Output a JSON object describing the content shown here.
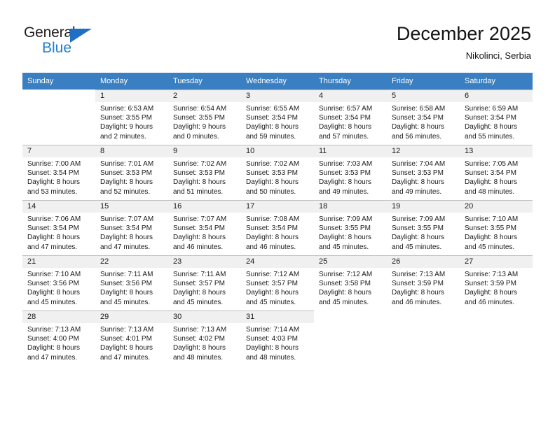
{
  "brand": {
    "name_part1": "General",
    "name_part2": "Blue",
    "triangle_color": "#1f6fc4",
    "blue_color": "#1f7fd0"
  },
  "header": {
    "month_title": "December 2025",
    "location": "Nikolinci, Serbia"
  },
  "calendar": {
    "header_bg": "#3a7fc1",
    "daynum_bg": "#f0f0f0",
    "weekday_headers": [
      "Sunday",
      "Monday",
      "Tuesday",
      "Wednesday",
      "Thursday",
      "Friday",
      "Saturday"
    ],
    "weeks": [
      [
        {
          "day": "",
          "sunrise": "",
          "sunset": "",
          "daylight_1": "",
          "daylight_2": "",
          "empty": true
        },
        {
          "day": "1",
          "sunrise": "Sunrise: 6:53 AM",
          "sunset": "Sunset: 3:55 PM",
          "daylight_1": "Daylight: 9 hours",
          "daylight_2": "and 2 minutes.",
          "empty": false
        },
        {
          "day": "2",
          "sunrise": "Sunrise: 6:54 AM",
          "sunset": "Sunset: 3:55 PM",
          "daylight_1": "Daylight: 9 hours",
          "daylight_2": "and 0 minutes.",
          "empty": false
        },
        {
          "day": "3",
          "sunrise": "Sunrise: 6:55 AM",
          "sunset": "Sunset: 3:54 PM",
          "daylight_1": "Daylight: 8 hours",
          "daylight_2": "and 59 minutes.",
          "empty": false
        },
        {
          "day": "4",
          "sunrise": "Sunrise: 6:57 AM",
          "sunset": "Sunset: 3:54 PM",
          "daylight_1": "Daylight: 8 hours",
          "daylight_2": "and 57 minutes.",
          "empty": false
        },
        {
          "day": "5",
          "sunrise": "Sunrise: 6:58 AM",
          "sunset": "Sunset: 3:54 PM",
          "daylight_1": "Daylight: 8 hours",
          "daylight_2": "and 56 minutes.",
          "empty": false
        },
        {
          "day": "6",
          "sunrise": "Sunrise: 6:59 AM",
          "sunset": "Sunset: 3:54 PM",
          "daylight_1": "Daylight: 8 hours",
          "daylight_2": "and 55 minutes.",
          "empty": false
        }
      ],
      [
        {
          "day": "7",
          "sunrise": "Sunrise: 7:00 AM",
          "sunset": "Sunset: 3:54 PM",
          "daylight_1": "Daylight: 8 hours",
          "daylight_2": "and 53 minutes.",
          "empty": false
        },
        {
          "day": "8",
          "sunrise": "Sunrise: 7:01 AM",
          "sunset": "Sunset: 3:53 PM",
          "daylight_1": "Daylight: 8 hours",
          "daylight_2": "and 52 minutes.",
          "empty": false
        },
        {
          "day": "9",
          "sunrise": "Sunrise: 7:02 AM",
          "sunset": "Sunset: 3:53 PM",
          "daylight_1": "Daylight: 8 hours",
          "daylight_2": "and 51 minutes.",
          "empty": false
        },
        {
          "day": "10",
          "sunrise": "Sunrise: 7:02 AM",
          "sunset": "Sunset: 3:53 PM",
          "daylight_1": "Daylight: 8 hours",
          "daylight_2": "and 50 minutes.",
          "empty": false
        },
        {
          "day": "11",
          "sunrise": "Sunrise: 7:03 AM",
          "sunset": "Sunset: 3:53 PM",
          "daylight_1": "Daylight: 8 hours",
          "daylight_2": "and 49 minutes.",
          "empty": false
        },
        {
          "day": "12",
          "sunrise": "Sunrise: 7:04 AM",
          "sunset": "Sunset: 3:53 PM",
          "daylight_1": "Daylight: 8 hours",
          "daylight_2": "and 49 minutes.",
          "empty": false
        },
        {
          "day": "13",
          "sunrise": "Sunrise: 7:05 AM",
          "sunset": "Sunset: 3:54 PM",
          "daylight_1": "Daylight: 8 hours",
          "daylight_2": "and 48 minutes.",
          "empty": false
        }
      ],
      [
        {
          "day": "14",
          "sunrise": "Sunrise: 7:06 AM",
          "sunset": "Sunset: 3:54 PM",
          "daylight_1": "Daylight: 8 hours",
          "daylight_2": "and 47 minutes.",
          "empty": false
        },
        {
          "day": "15",
          "sunrise": "Sunrise: 7:07 AM",
          "sunset": "Sunset: 3:54 PM",
          "daylight_1": "Daylight: 8 hours",
          "daylight_2": "and 47 minutes.",
          "empty": false
        },
        {
          "day": "16",
          "sunrise": "Sunrise: 7:07 AM",
          "sunset": "Sunset: 3:54 PM",
          "daylight_1": "Daylight: 8 hours",
          "daylight_2": "and 46 minutes.",
          "empty": false
        },
        {
          "day": "17",
          "sunrise": "Sunrise: 7:08 AM",
          "sunset": "Sunset: 3:54 PM",
          "daylight_1": "Daylight: 8 hours",
          "daylight_2": "and 46 minutes.",
          "empty": false
        },
        {
          "day": "18",
          "sunrise": "Sunrise: 7:09 AM",
          "sunset": "Sunset: 3:55 PM",
          "daylight_1": "Daylight: 8 hours",
          "daylight_2": "and 45 minutes.",
          "empty": false
        },
        {
          "day": "19",
          "sunrise": "Sunrise: 7:09 AM",
          "sunset": "Sunset: 3:55 PM",
          "daylight_1": "Daylight: 8 hours",
          "daylight_2": "and 45 minutes.",
          "empty": false
        },
        {
          "day": "20",
          "sunrise": "Sunrise: 7:10 AM",
          "sunset": "Sunset: 3:55 PM",
          "daylight_1": "Daylight: 8 hours",
          "daylight_2": "and 45 minutes.",
          "empty": false
        }
      ],
      [
        {
          "day": "21",
          "sunrise": "Sunrise: 7:10 AM",
          "sunset": "Sunset: 3:56 PM",
          "daylight_1": "Daylight: 8 hours",
          "daylight_2": "and 45 minutes.",
          "empty": false
        },
        {
          "day": "22",
          "sunrise": "Sunrise: 7:11 AM",
          "sunset": "Sunset: 3:56 PM",
          "daylight_1": "Daylight: 8 hours",
          "daylight_2": "and 45 minutes.",
          "empty": false
        },
        {
          "day": "23",
          "sunrise": "Sunrise: 7:11 AM",
          "sunset": "Sunset: 3:57 PM",
          "daylight_1": "Daylight: 8 hours",
          "daylight_2": "and 45 minutes.",
          "empty": false
        },
        {
          "day": "24",
          "sunrise": "Sunrise: 7:12 AM",
          "sunset": "Sunset: 3:57 PM",
          "daylight_1": "Daylight: 8 hours",
          "daylight_2": "and 45 minutes.",
          "empty": false
        },
        {
          "day": "25",
          "sunrise": "Sunrise: 7:12 AM",
          "sunset": "Sunset: 3:58 PM",
          "daylight_1": "Daylight: 8 hours",
          "daylight_2": "and 45 minutes.",
          "empty": false
        },
        {
          "day": "26",
          "sunrise": "Sunrise: 7:13 AM",
          "sunset": "Sunset: 3:59 PM",
          "daylight_1": "Daylight: 8 hours",
          "daylight_2": "and 46 minutes.",
          "empty": false
        },
        {
          "day": "27",
          "sunrise": "Sunrise: 7:13 AM",
          "sunset": "Sunset: 3:59 PM",
          "daylight_1": "Daylight: 8 hours",
          "daylight_2": "and 46 minutes.",
          "empty": false
        }
      ],
      [
        {
          "day": "28",
          "sunrise": "Sunrise: 7:13 AM",
          "sunset": "Sunset: 4:00 PM",
          "daylight_1": "Daylight: 8 hours",
          "daylight_2": "and 47 minutes.",
          "empty": false
        },
        {
          "day": "29",
          "sunrise": "Sunrise: 7:13 AM",
          "sunset": "Sunset: 4:01 PM",
          "daylight_1": "Daylight: 8 hours",
          "daylight_2": "and 47 minutes.",
          "empty": false
        },
        {
          "day": "30",
          "sunrise": "Sunrise: 7:13 AM",
          "sunset": "Sunset: 4:02 PM",
          "daylight_1": "Daylight: 8 hours",
          "daylight_2": "and 48 minutes.",
          "empty": false
        },
        {
          "day": "31",
          "sunrise": "Sunrise: 7:14 AM",
          "sunset": "Sunset: 4:03 PM",
          "daylight_1": "Daylight: 8 hours",
          "daylight_2": "and 48 minutes.",
          "empty": false
        },
        {
          "day": "",
          "sunrise": "",
          "sunset": "",
          "daylight_1": "",
          "daylight_2": "",
          "empty": true
        },
        {
          "day": "",
          "sunrise": "",
          "sunset": "",
          "daylight_1": "",
          "daylight_2": "",
          "empty": true
        },
        {
          "day": "",
          "sunrise": "",
          "sunset": "",
          "daylight_1": "",
          "daylight_2": "",
          "empty": true
        }
      ]
    ]
  }
}
